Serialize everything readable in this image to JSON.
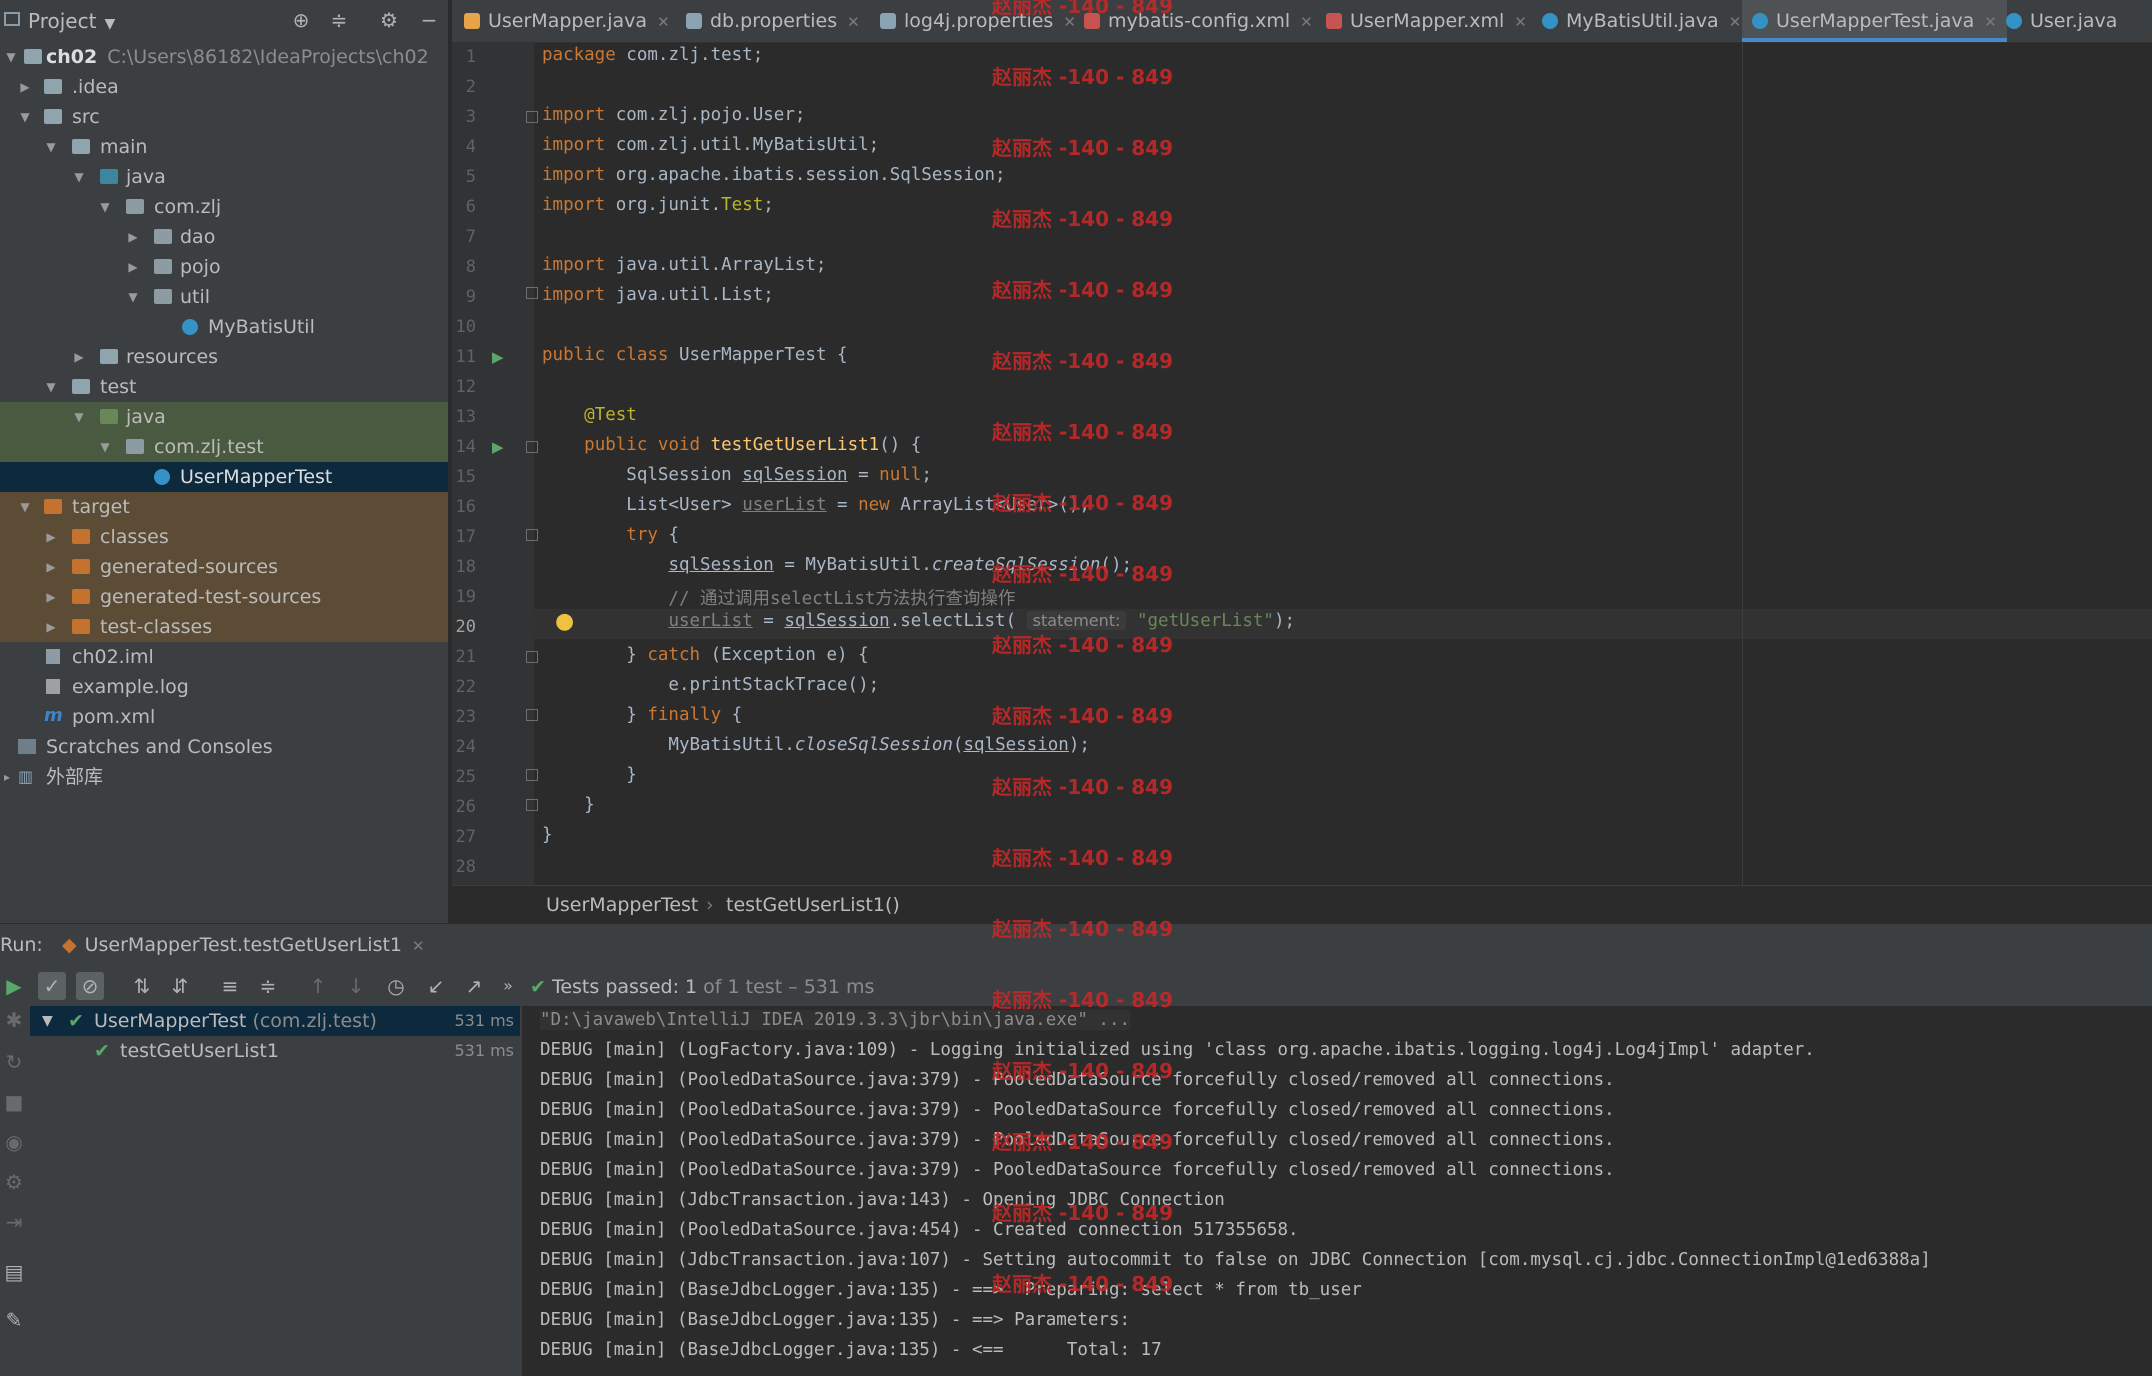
{
  "project": {
    "title": "Project",
    "tree": [
      {
        "label": "ch02",
        "path": "C:\\Users\\86182\\IdeaProjects\\ch02"
      },
      {
        "label": ".idea"
      },
      {
        "label": "src"
      },
      {
        "label": "main"
      },
      {
        "label": "java"
      },
      {
        "label": "com.zlj"
      },
      {
        "label": "dao"
      },
      {
        "label": "pojo"
      },
      {
        "label": "util"
      },
      {
        "label": "MyBatisUtil"
      },
      {
        "label": "resources"
      },
      {
        "label": "test"
      },
      {
        "label": "java"
      },
      {
        "label": "com.zlj.test"
      },
      {
        "label": "UserMapperTest"
      },
      {
        "label": "target"
      },
      {
        "label": "classes"
      },
      {
        "label": "generated-sources"
      },
      {
        "label": "generated-test-sources"
      },
      {
        "label": "test-classes"
      },
      {
        "label": "ch02.iml"
      },
      {
        "label": "example.log"
      },
      {
        "label": "pom.xml"
      },
      {
        "label": "Scratches and Consoles"
      },
      {
        "label": "外部库"
      }
    ]
  },
  "tabs": [
    {
      "label": "UserMapper.java"
    },
    {
      "label": "db.properties"
    },
    {
      "label": "log4j.properties"
    },
    {
      "label": "mybatis-config.xml"
    },
    {
      "label": "UserMapper.xml"
    },
    {
      "label": "MyBatisUtil.java"
    },
    {
      "label": "UserMapperTest.java"
    },
    {
      "label": "User.java"
    }
  ],
  "editor": {
    "line_numbers": [
      "1",
      "2",
      "3",
      "4",
      "5",
      "6",
      "7",
      "8",
      "9",
      "10",
      "11",
      "12",
      "13",
      "14",
      "15",
      "16",
      "17",
      "18",
      "19",
      "20",
      "21",
      "22",
      "23",
      "24",
      "25",
      "26",
      "27",
      "28"
    ],
    "current_line": "20",
    "param_hint": "statement:",
    "breadcrumb": [
      "UserMapperTest",
      "testGetUserList1()"
    ]
  },
  "run": {
    "label": "Run:",
    "tab": "UserMapperTest.testGetUserList1",
    "status_prefix": "Tests passed:",
    "status_count": "1",
    "status_rest": "of 1 test – 531 ms",
    "tests": [
      {
        "name": "UserMapperTest",
        "pkg": "(com.zlj.test)",
        "duration": "531 ms"
      },
      {
        "name": "testGetUserList1",
        "duration": "531 ms"
      }
    ],
    "console": [
      "\"D:\\javaweb\\IntelliJ IDEA 2019.3.3\\jbr\\bin\\java.exe\" ...",
      "DEBUG [main] (LogFactory.java:109) - Logging initialized using 'class org.apache.ibatis.logging.log4j.Log4jImpl' adapter.",
      "DEBUG [main] (PooledDataSource.java:379) - PooledDataSource forcefully closed/removed all connections.",
      "DEBUG [main] (PooledDataSource.java:379) - PooledDataSource forcefully closed/removed all connections.",
      "DEBUG [main] (PooledDataSource.java:379) - PooledDataSource forcefully closed/removed all connections.",
      "DEBUG [main] (PooledDataSource.java:379) - PooledDataSource forcefully closed/removed all connections.",
      "DEBUG [main] (JdbcTransaction.java:143) - Opening JDBC Connection",
      "DEBUG [main] (PooledDataSource.java:454) - Created connection 517355658.",
      "DEBUG [main] (JdbcTransaction.java:107) - Setting autocommit to false on JDBC Connection [com.mysql.cj.jdbc.ConnectionImpl@1ed6388a]",
      "DEBUG [main] (BaseJdbcLogger.java:135) - ==>  Preparing: select * from tb_user",
      "DEBUG [main] (BaseJdbcLogger.java:135) - ==> Parameters: ",
      "DEBUG [main] (BaseJdbcLogger.java:135) - <==      Total: 17"
    ]
  },
  "watermark": "赵丽杰 -140 - 849",
  "colors": {
    "accent": "#4a88c7",
    "pass": "#59a869",
    "watermark": "#c62828"
  }
}
